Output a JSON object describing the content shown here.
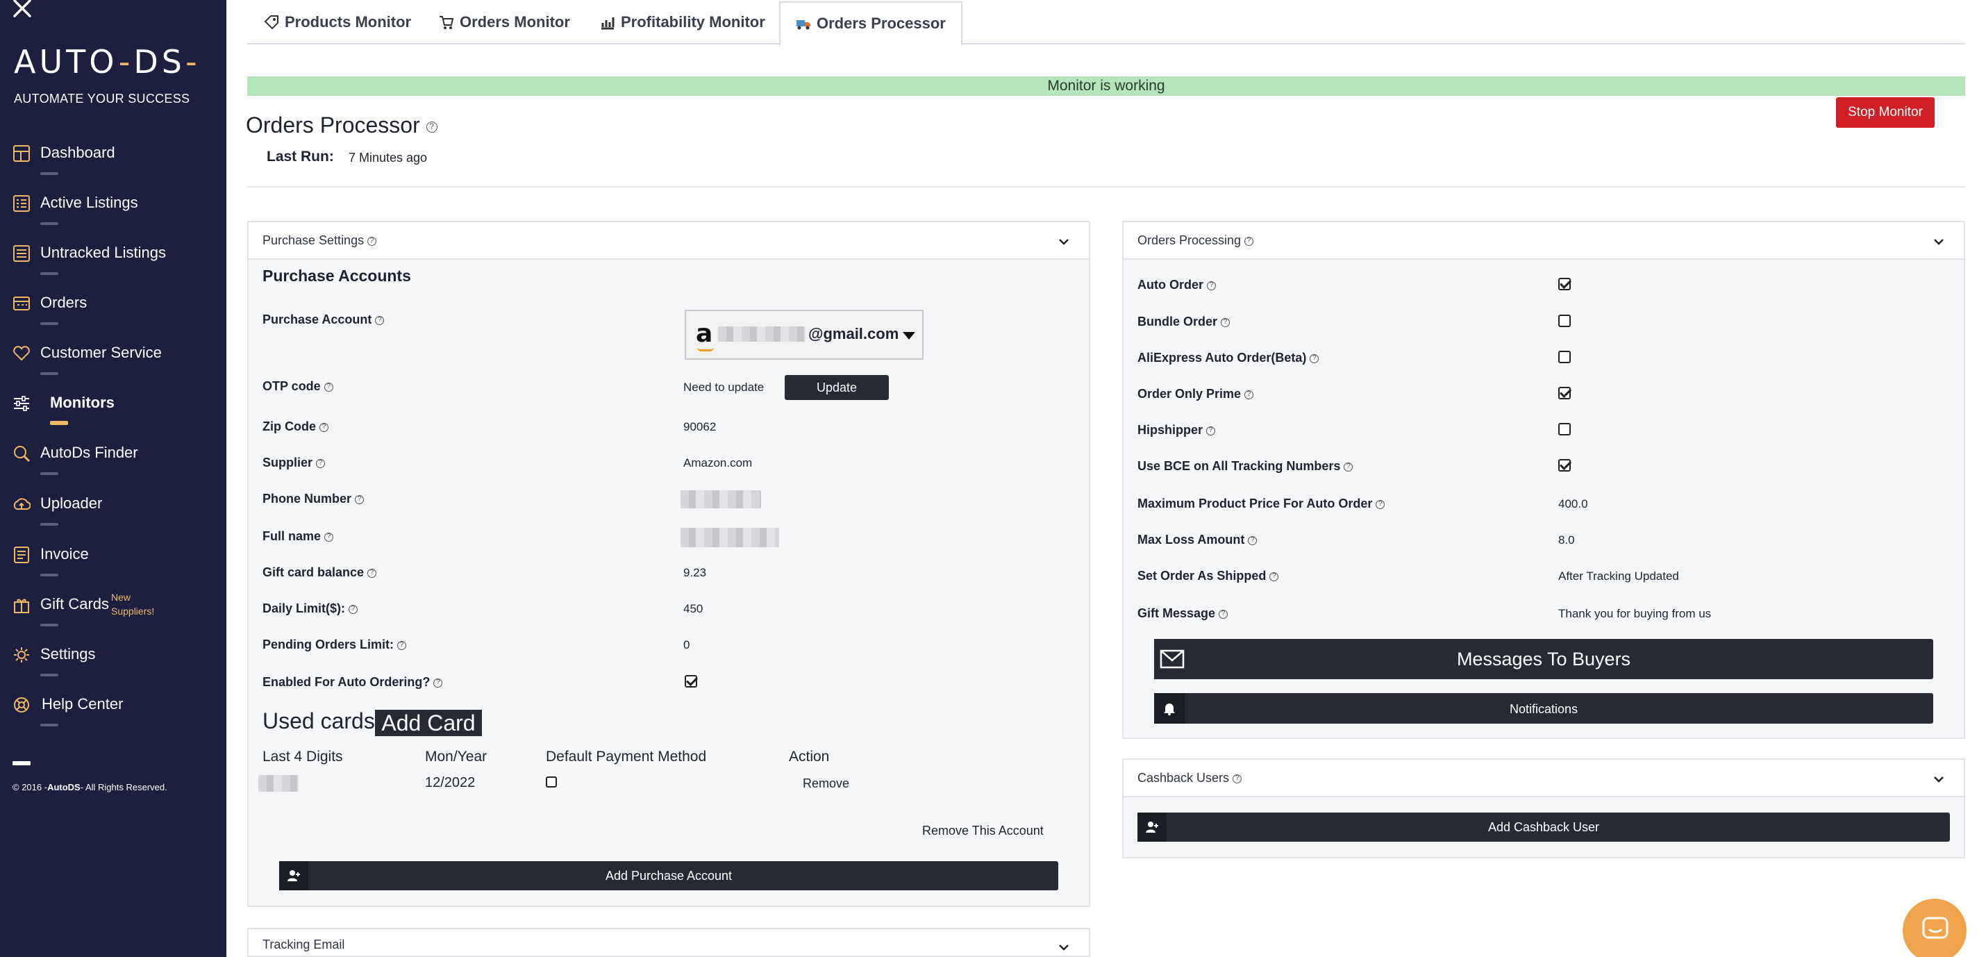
{
  "sidebar": {
    "logo_main": "AUTO-DS-",
    "tagline": "AUTOMATE YOUR SUCCESS",
    "items": [
      {
        "label": "Dashboard",
        "icon": "dashboard-icon"
      },
      {
        "label": "Active Listings",
        "icon": "listings-icon"
      },
      {
        "label": "Untracked Listings",
        "icon": "untracked-icon"
      },
      {
        "label": "Orders",
        "icon": "orders-icon"
      },
      {
        "label": "Customer Service",
        "icon": "heart-icon"
      },
      {
        "label": "Monitors",
        "icon": "sliders-icon"
      },
      {
        "label": "AutoDs Finder",
        "icon": "finder-icon"
      },
      {
        "label": "Uploader",
        "icon": "upload-icon"
      },
      {
        "label": "Invoice",
        "icon": "invoice-icon"
      },
      {
        "label": "Gift Cards",
        "icon": "gift-icon",
        "badge_line1": "New",
        "badge_line2": "Suppliers!"
      },
      {
        "label": "Settings",
        "icon": "settings-icon"
      },
      {
        "label": "Help Center",
        "icon": "help-center-icon"
      }
    ],
    "copyright_prefix": "© 2016 -",
    "copyright_brand": "AutoDS",
    "copyright_suffix": "- All Rights Reserved."
  },
  "tabs": [
    {
      "label": "Products Monitor",
      "icon": "tag-icon"
    },
    {
      "label": "Orders Monitor",
      "icon": "cart-icon"
    },
    {
      "label": "Profitability Monitor",
      "icon": "chart-icon"
    },
    {
      "label": "Orders Processor",
      "icon": "truck-icon"
    }
  ],
  "status_text": "Monitor is working",
  "page_title": "Orders Processor",
  "stop_button": "Stop Monitor",
  "last_run": {
    "label": "Last Run:",
    "value": "7 Minutes ago"
  },
  "purchase_settings": {
    "title": "Purchase Settings",
    "section_title": "Purchase Accounts",
    "account_email_suffix": "@gmail.com",
    "fields": {
      "purchase_account": "Purchase Account",
      "otp_label": "OTP code",
      "otp_status": "Need to update",
      "otp_button": "Update",
      "zip_label": "Zip Code",
      "zip_value": "90062",
      "supplier_label": "Supplier",
      "supplier_value": "Amazon.com",
      "phone_label": "Phone Number",
      "fullname_label": "Full name",
      "gift_label": "Gift card balance",
      "gift_value": "9.23",
      "daily_label": "Daily Limit($):",
      "daily_value": "450",
      "pending_label": "Pending Orders Limit:",
      "pending_value": "0",
      "enabled_label": "Enabled For Auto Ordering?",
      "enabled_checked": true
    },
    "used_cards": {
      "title": "Used cards",
      "add_button": "Add Card",
      "headers": [
        "Last 4 Digits",
        "Mon/Year",
        "Default Payment Method",
        "Action"
      ],
      "rows": [
        {
          "expiry": "12/2022",
          "default": false,
          "action": "Remove"
        }
      ]
    },
    "remove_account": "Remove This Account",
    "add_account_button": "Add Purchase Account"
  },
  "tracking_email": {
    "title": "Tracking Email"
  },
  "orders_processing": {
    "title": "Orders Processing",
    "rows": [
      {
        "label": "Auto Order",
        "type": "checkbox",
        "checked": true
      },
      {
        "label": "Bundle Order",
        "type": "checkbox",
        "checked": false
      },
      {
        "label": "AliExpress Auto Order(Beta)",
        "type": "checkbox",
        "checked": false
      },
      {
        "label": "Order Only Prime",
        "type": "checkbox",
        "checked": true
      },
      {
        "label": "Hipshipper",
        "type": "checkbox",
        "checked": false
      },
      {
        "label": "Use BCE on All Tracking Numbers",
        "type": "checkbox",
        "checked": true
      },
      {
        "label": "Maximum Product Price For Auto Order",
        "type": "value",
        "value": "400.0"
      },
      {
        "label": "Max Loss Amount",
        "type": "value",
        "value": "8.0"
      },
      {
        "label": "Set Order As Shipped",
        "type": "value",
        "value": "After Tracking Updated"
      },
      {
        "label": "Gift Message",
        "type": "value",
        "value": "Thank you for buying from us"
      }
    ],
    "messages_button": "Messages To Buyers",
    "notifications_button": "Notifications"
  },
  "cashback": {
    "title": "Cashback Users",
    "add_button": "Add Cashback User"
  },
  "colors": {
    "sidebar_bg": "#1c1f3d",
    "accent": "#f0b866",
    "stop_red": "#cf2027",
    "status_green": "#b5e6bb",
    "dark_button": "#262a33"
  }
}
